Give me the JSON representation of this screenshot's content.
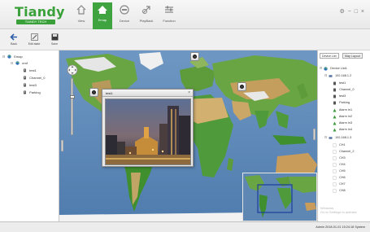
{
  "app": {
    "logo_text": "Tiandy",
    "logo_tag": "TIANDY TECH"
  },
  "nav": {
    "items": [
      {
        "label": "View",
        "icon": "home-icon"
      },
      {
        "label": "Emap",
        "icon": "map-icon",
        "active": true
      },
      {
        "label": "Device",
        "icon": "device-icon"
      },
      {
        "label": "PlayBack",
        "icon": "playback-icon"
      },
      {
        "label": "Function",
        "icon": "function-icon"
      }
    ],
    "window_controls": "⚙ − □ ×"
  },
  "toolbar": {
    "items": [
      {
        "label": "Back",
        "icon": "back-arrow-icon"
      },
      {
        "label": "Edit state",
        "icon": "edit-icon"
      },
      {
        "label": "Save",
        "icon": "save-icon"
      }
    ]
  },
  "left_tree": {
    "rows": [
      {
        "label": "Emap",
        "icon": "globe-icon",
        "expander": "⊟"
      },
      {
        "label": "emf",
        "icon": "globe-icon",
        "expander": "⊟"
      },
      {
        "label": "test1",
        "icon": "camera-icon",
        "expander": ""
      },
      {
        "label": "Channel_0",
        "icon": "camera-icon",
        "expander": ""
      },
      {
        "label": "test3",
        "icon": "camera-icon",
        "expander": ""
      },
      {
        "label": "Parking",
        "icon": "camera-icon",
        "expander": ""
      }
    ]
  },
  "popup": {
    "title": "test1",
    "close": "×"
  },
  "right_panel": {
    "tabs": [
      "Device List",
      "Map Layout"
    ],
    "rows": [
      {
        "label": "Device List1",
        "icon": "globe-icon",
        "expander": "⊟"
      },
      {
        "label": "192.168.1.2",
        "icon": "dvr-icon",
        "expander": "⊟"
      },
      {
        "label": "test1",
        "icon": "camera-icon",
        "expander": ""
      },
      {
        "label": "Channel_0",
        "icon": "camera-icon",
        "expander": ""
      },
      {
        "label": "test3",
        "icon": "camera-icon",
        "expander": ""
      },
      {
        "label": "Parking",
        "icon": "camera-icon",
        "expander": ""
      },
      {
        "label": "Alarm In1",
        "icon": "alarm-icon",
        "expander": ""
      },
      {
        "label": "Alarm In2",
        "icon": "alarm-icon",
        "expander": ""
      },
      {
        "label": "Alarm In3",
        "icon": "alarm-icon",
        "expander": ""
      },
      {
        "label": "Alarm In4",
        "icon": "alarm-icon",
        "expander": ""
      },
      {
        "label": "192.168.1.3",
        "icon": "dvr-icon",
        "expander": "⊟"
      },
      {
        "label": "CH1",
        "icon": "blank-icon",
        "expander": ""
      },
      {
        "label": "Channel_2",
        "icon": "blank-icon",
        "expander": ""
      },
      {
        "label": "CH3",
        "icon": "blank-icon",
        "expander": ""
      },
      {
        "label": "CH4",
        "icon": "blank-icon",
        "expander": ""
      },
      {
        "label": "CH5",
        "icon": "blank-icon",
        "expander": ""
      },
      {
        "label": "CH6",
        "icon": "blank-icon",
        "expander": ""
      },
      {
        "label": "CH7",
        "icon": "blank-icon",
        "expander": ""
      },
      {
        "label": "CH8",
        "icon": "blank-icon",
        "expander": ""
      }
    ],
    "watermark_line1": "Windows",
    "watermark_line2": "Go to Settings to activate"
  },
  "status": {
    "text": "Admin 2018-01-01 15:24:18 System"
  },
  "colors": {
    "accent": "#3fa33f",
    "ocean": "#5b86b4",
    "land_green": "#4f9a3b",
    "land_desert": "#c8a768"
  }
}
